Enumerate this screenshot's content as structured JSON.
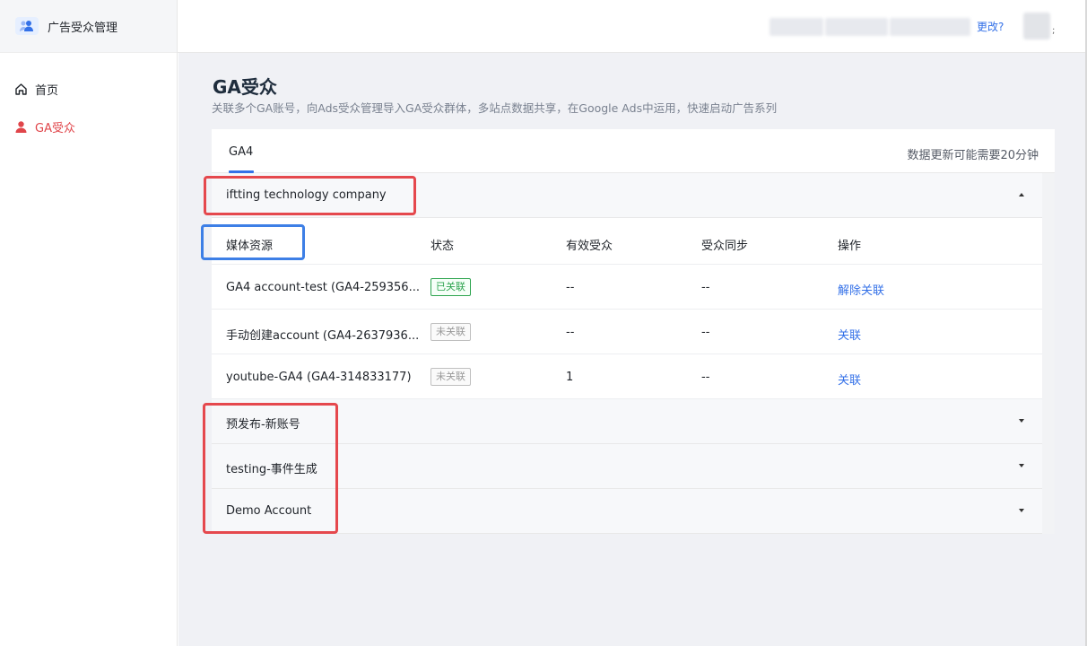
{
  "app": {
    "title": "广告受众管理"
  },
  "sidebar": {
    "items": [
      {
        "label": "首页",
        "icon": "home-icon"
      },
      {
        "label": "GA受众",
        "icon": "user-icon",
        "active": true
      }
    ]
  },
  "header": {
    "update_link": "更改?",
    "tail": ";"
  },
  "page": {
    "title": "GA受众",
    "description": "关联多个GA账号，向Ads受众管理导入GA受众群体，多站点数据共享，在Google Ads中运用，快速启动广告系列"
  },
  "tabs": [
    {
      "label": "GA4",
      "active": true
    }
  ],
  "tab_note": "数据更新可能需要20分钟",
  "groups": [
    {
      "name": "iftting technology company",
      "expanded": true
    },
    {
      "name": "预发布-新账号",
      "expanded": false
    },
    {
      "name": "testing-事件生成",
      "expanded": false
    },
    {
      "name": "Demo Account",
      "expanded": false
    }
  ],
  "table": {
    "columns": [
      "媒体资源",
      "状态",
      "有效受众",
      "受众同步",
      "操作"
    ],
    "rows": [
      {
        "resource": "GA4 account-test (GA4-259356...",
        "status": "已关联",
        "linked": true,
        "audience": "--",
        "sync": "--",
        "action": "解除关联"
      },
      {
        "resource": "手动创建account (GA4-2637936...",
        "status": "未关联",
        "linked": false,
        "audience": "--",
        "sync": "--",
        "action": "关联"
      },
      {
        "resource": "youtube-GA4 (GA4-314833177)",
        "status": "未关联",
        "linked": false,
        "audience": "1",
        "sync": "--",
        "action": "关联"
      }
    ]
  },
  "colors": {
    "accent": "#3471e8",
    "active_nav": "#e0454a",
    "linked": "#2ea44f",
    "annotation_red": "#e5484d",
    "annotation_blue": "#3d7fe6"
  }
}
